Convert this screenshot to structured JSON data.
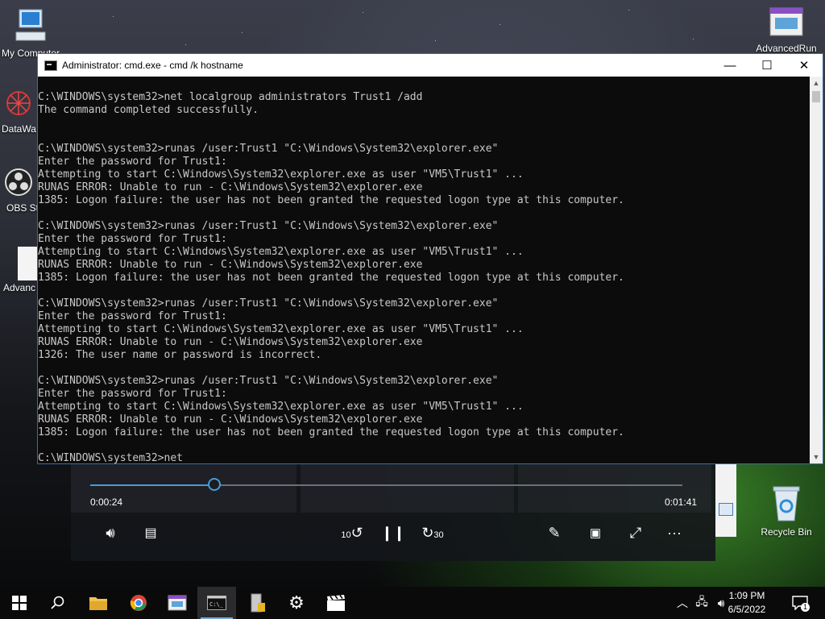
{
  "desktop": {
    "icons": [
      {
        "label": "My Computer",
        "icon": "computer-icon"
      },
      {
        "label": "DataWa",
        "icon": "datawave-icon"
      },
      {
        "label": "OBS St",
        "icon": "obs-icon"
      },
      {
        "label": "Advanc",
        "icon": "document-icon"
      },
      {
        "label": "Recycle Bin",
        "icon": "recycle-bin-icon"
      },
      {
        "label": "AdvancedRun",
        "icon": "advancedrun-icon"
      }
    ]
  },
  "cmd": {
    "title": "Administrator: cmd.exe - cmd  /k hostname",
    "controls": {
      "minimize": "—",
      "maximize": "☐",
      "close": "✕"
    },
    "lines": [
      "C:\\WINDOWS\\system32>net localgroup administrators Trust1 /add",
      "The command completed successfully.",
      "",
      "",
      "C:\\WINDOWS\\system32>runas /user:Trust1 \"C:\\Windows\\System32\\explorer.exe\"",
      "Enter the password for Trust1:",
      "Attempting to start C:\\Windows\\System32\\explorer.exe as user \"VM5\\Trust1\" ...",
      "RUNAS ERROR: Unable to run - C:\\Windows\\System32\\explorer.exe",
      "1385: Logon failure: the user has not been granted the requested logon type at this computer.",
      "",
      "C:\\WINDOWS\\system32>runas /user:Trust1 \"C:\\Windows\\System32\\explorer.exe\"",
      "Enter the password for Trust1:",
      "Attempting to start C:\\Windows\\System32\\explorer.exe as user \"VM5\\Trust1\" ...",
      "RUNAS ERROR: Unable to run - C:\\Windows\\System32\\explorer.exe",
      "1385: Logon failure: the user has not been granted the requested logon type at this computer.",
      "",
      "C:\\WINDOWS\\system32>runas /user:Trust1 \"C:\\Windows\\System32\\explorer.exe\"",
      "Enter the password for Trust1:",
      "Attempting to start C:\\Windows\\System32\\explorer.exe as user \"VM5\\Trust1\" ...",
      "RUNAS ERROR: Unable to run - C:\\Windows\\System32\\explorer.exe",
      "1326: The user name or password is incorrect.",
      "",
      "C:\\WINDOWS\\system32>runas /user:Trust1 \"C:\\Windows\\System32\\explorer.exe\"",
      "Enter the password for Trust1:",
      "Attempting to start C:\\Windows\\System32\\explorer.exe as user \"VM5\\Trust1\" ...",
      "RUNAS ERROR: Unable to run - C:\\Windows\\System32\\explorer.exe",
      "1385: Logon failure: the user has not been granted the requested logon type at this computer.",
      "",
      "C:\\WINDOWS\\system32>net"
    ]
  },
  "player": {
    "current_time": "0:00:24",
    "remaining_time": "0:01:41",
    "progress": 0.21,
    "skip_back_label": "10",
    "skip_forward_label": "30",
    "accent": "#4a9ad6"
  },
  "taskbar": {
    "apps": [
      {
        "name": "file-explorer",
        "icon": "folder-icon"
      },
      {
        "name": "chrome",
        "icon": "chrome-icon"
      },
      {
        "name": "advancedrun",
        "icon": "advancedrun-icon"
      },
      {
        "name": "cmd",
        "icon": "cmd-icon",
        "active": true
      },
      {
        "name": "server-manager",
        "icon": "server-icon"
      },
      {
        "name": "settings",
        "icon": "gear-icon"
      },
      {
        "name": "movies",
        "icon": "clapper-icon"
      }
    ],
    "time": "1:09 PM",
    "date": "6/5/2022",
    "notification_count": "1"
  }
}
